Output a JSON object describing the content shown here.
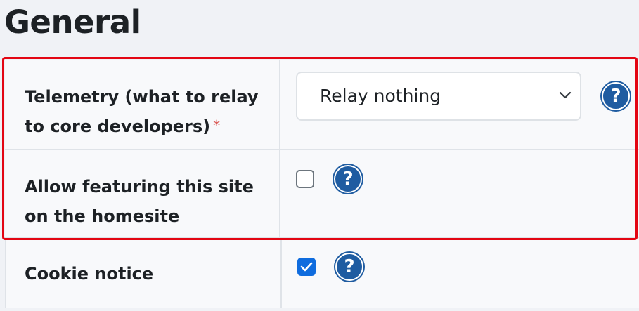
{
  "page": {
    "title": "General"
  },
  "settings": {
    "telemetry": {
      "label_line1": "Telemetry (what to relay",
      "label_line2": "to core developers)",
      "required_mark": "*",
      "selected_value": "Relay nothing",
      "help_glyph": "?"
    },
    "featuring": {
      "label_line1": "Allow featuring this site",
      "label_line2": "on the homesite",
      "checked": false,
      "help_glyph": "?"
    },
    "cookie": {
      "label": "Cookie notice",
      "checked": true,
      "help_glyph": "?"
    }
  },
  "icons": {
    "help": "question-circle-icon",
    "dropdown": "chevron-down-icon",
    "check": "checkmark-icon"
  },
  "colors": {
    "accent": "#1f5ca1",
    "checkbox_checked": "#0f6cde",
    "required": "#d9534f",
    "highlight": "#e30613"
  }
}
